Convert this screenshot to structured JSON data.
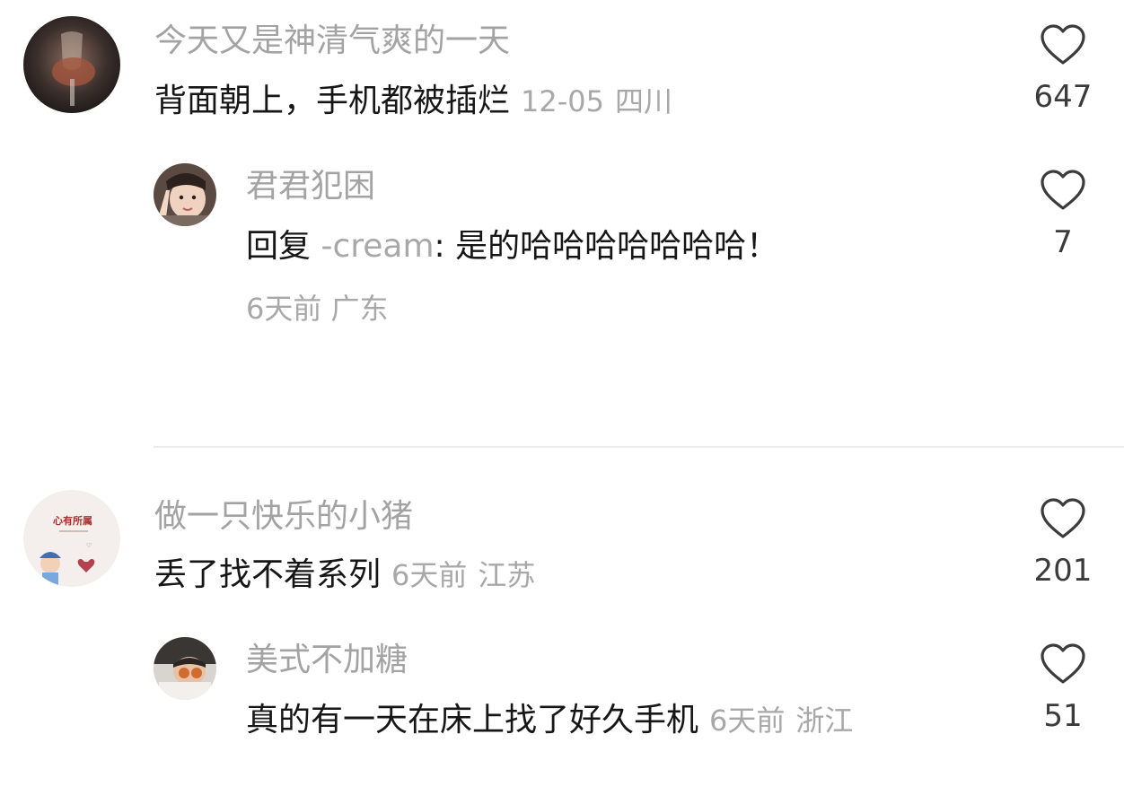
{
  "comments": [
    {
      "username": "今天又是神清气爽的一天",
      "text": "背面朝上，手机都被插烂",
      "date": "12-05",
      "location": "四川",
      "likes": "647",
      "replies": [
        {
          "username": "君君犯困",
          "reply_prefix": "回复",
          "reply_target": "-cream",
          "text": ": 是的哈哈哈哈哈哈哈！",
          "date": "6天前",
          "location": "广东",
          "likes": "7"
        }
      ]
    },
    {
      "username": "做一只快乐的小猪",
      "text": "丢了找不着系列",
      "date": "6天前",
      "location": "江苏",
      "likes": "201",
      "avatar_text": "心有所属",
      "replies": [
        {
          "username": "美式不加糖",
          "text": "真的有一天在床上找了好久手机",
          "date": "6天前",
          "location": "浙江",
          "likes": "51"
        }
      ]
    }
  ],
  "icons": {
    "like": "heart-outline-icon"
  },
  "colors": {
    "username": "#a3a3a3",
    "body_text": "#161616",
    "meta": "#a8a8a8",
    "like_icon": "#3b3b3b",
    "divider": "#ececec"
  }
}
